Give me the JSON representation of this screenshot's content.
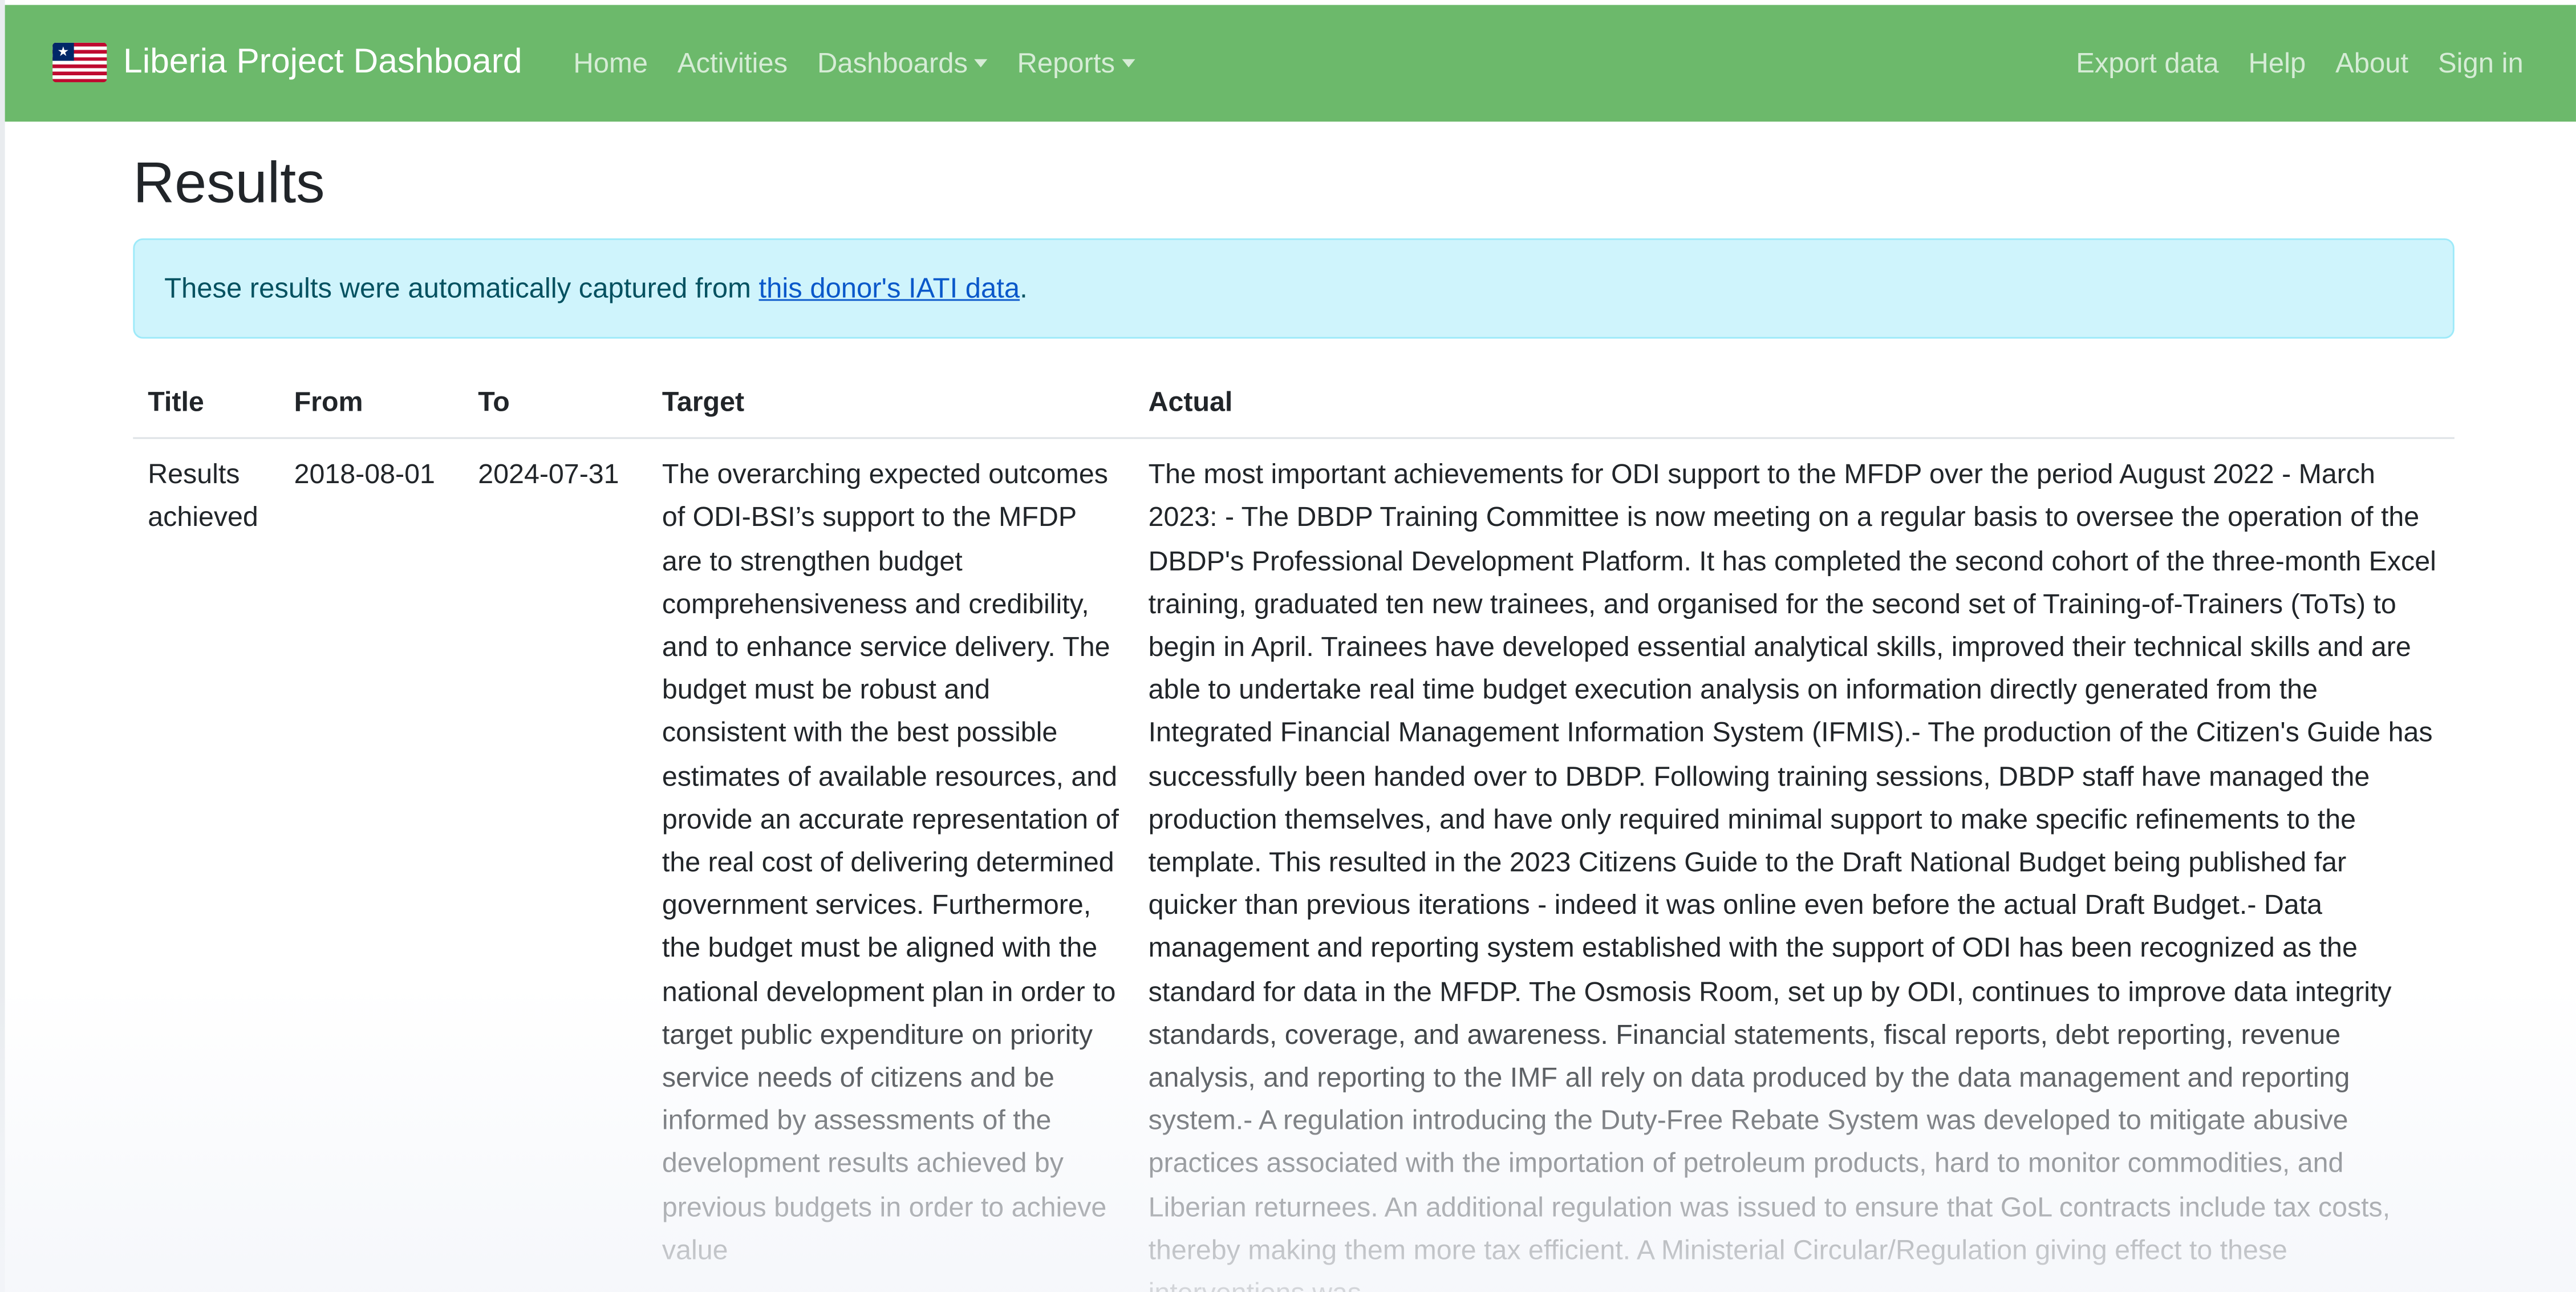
{
  "navbar": {
    "brand": "Liberia Project Dashboard",
    "brand_icon": "liberia-flag-icon",
    "colors": {
      "navbar_bg": "#6cb96b",
      "alert_bg": "#cff4fc",
      "link": "#0a58ca"
    },
    "left_links": [
      {
        "label": "Home"
      },
      {
        "label": "Activities"
      },
      {
        "label": "Dashboards",
        "dropdown": true
      },
      {
        "label": "Reports",
        "dropdown": true
      }
    ],
    "right_links": [
      {
        "label": "Export data"
      },
      {
        "label": "Help"
      },
      {
        "label": "About"
      },
      {
        "label": "Sign in"
      }
    ]
  },
  "page": {
    "title": "Results",
    "alert": {
      "prefix": "These results were automatically captured from ",
      "link": "this donor's IATI data",
      "suffix": "."
    }
  },
  "table": {
    "headers": [
      "Title",
      "From",
      "To",
      "Target",
      "Actual"
    ],
    "rows": [
      {
        "title": "Results achieved",
        "from": "2018-08-01",
        "to": "2024-07-31",
        "target": "The overarching expected outcomes of ODI-BSI’s support to the MFDP are to strengthen budget comprehensiveness and credibility, and to enhance service delivery. The budget must be robust and consistent with the best possible estimates of available resources, and provide an accurate representation of the real cost of delivering determined government services. Furthermore, the budget must be aligned with the national development plan in order to target public expenditure on priority service needs of citizens and be informed by assessments of the development results achieved by previous budgets in order to achieve value",
        "actual": "The most important achievements for ODI support to the MFDP over the period August 2022 - March 2023: - The DBDP Training Committee is now meeting on a regular basis to oversee the operation of the DBDP's Professional Development Platform. It has completed the second cohort of the three-month Excel training, graduated ten new trainees, and organised for the second set of Training-of-Trainers (ToTs) to begin in April. Trainees have developed essential analytical skills, improved their technical skills and are able to undertake real time budget execution analysis on information directly generated from the Integrated Financial Management Information System (IFMIS).- The production of the Citizen's Guide has successfully been handed over to DBDP. Following training sessions, DBDP staff have managed the production themselves, and have only required minimal support to make specific refinements to the template. This resulted in the 2023 Citizens Guide to the Draft National Budget being published far quicker than previous iterations - indeed it was online even before the actual Draft Budget.- Data management and reporting system established with the support of ODI has been recognized as the standard for data in the MFDP. The Osmosis Room, set up by ODI, continues to improve data integrity standards, coverage, and awareness. Financial statements, fiscal reports, debt reporting, revenue analysis, and reporting to the IMF all rely on data produced by the data management and reporting system.- A regulation introducing the Duty-Free Rebate System was developed to mitigate abusive practices associated with the importation of petroleum products, hard to monitor commodities, and Liberian returnees. An additional regulation was issued to ensure that GoL contracts include tax costs, thereby making them more tax efficient. A Ministerial Circular/Regulation giving effect to these interventions was"
      }
    ]
  }
}
